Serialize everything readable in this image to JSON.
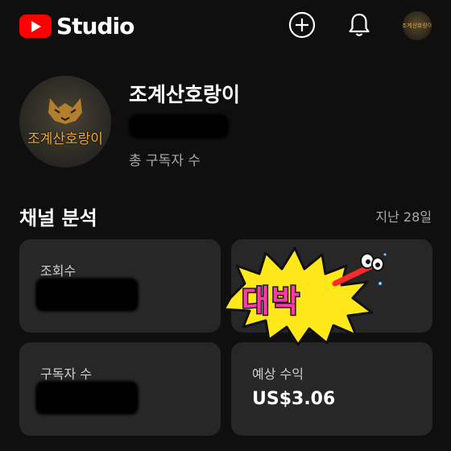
{
  "app": {
    "logo_text": "Studio"
  },
  "header": {
    "create_icon": "plus-circle-icon",
    "notification_icon": "bell-icon",
    "avatar_text": "조계산호랑이"
  },
  "channel": {
    "name": "조계산호랑이",
    "avatar_text": "조계산호랑이",
    "subscribers_label": "총 구독자 수"
  },
  "analytics": {
    "title": "채널 분석",
    "period": "지난 28일",
    "cards": [
      {
        "label": "조회수",
        "value": ""
      },
      {
        "label": "",
        "value": ""
      },
      {
        "label": "구독자 수",
        "value": ""
      },
      {
        "label": "예상 수익",
        "value": "US$3.06"
      }
    ]
  },
  "sticker": {
    "text": "대박"
  },
  "colors": {
    "brand_red": "#ff0000",
    "background": "#0f0f0f",
    "card": "#272727",
    "sticker_pink": "#ff3aa6",
    "sticker_yellow": "#ffe81a"
  }
}
